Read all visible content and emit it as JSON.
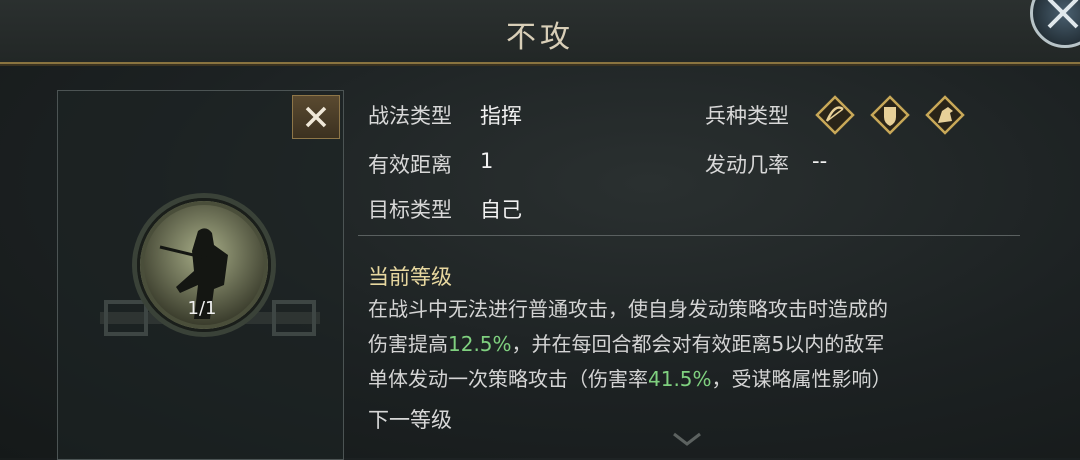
{
  "header": {
    "title": "不攻"
  },
  "skill": {
    "level_display": "1/1"
  },
  "info": {
    "tactic_type_label": "战法类型",
    "tactic_type_value": "指挥",
    "range_label": "有效距离",
    "range_value": "1",
    "target_label": "目标类型",
    "target_value": "自己",
    "unit_type_label": "兵种类型",
    "unit_icons": [
      "archer-icon",
      "shield-infantry-icon",
      "cavalry-icon"
    ],
    "trigger_label": "发动几率",
    "trigger_value": "--"
  },
  "current_level": {
    "title": "当前等级",
    "line1": "在战斗中无法进行普通攻击，使自身发动策略攻击时造成的",
    "line2_a": "伤害提高",
    "line2_hl": "12.5%",
    "line2_b": "，并在每回合都会对有效距离5以内的敌军",
    "line3_a": "单体发动一次策略攻击（伤害率",
    "line3_hl": "41.5%",
    "line3_b": "，受谋略属性影响）"
  },
  "next_level": {
    "title": "下一等级"
  },
  "colors": {
    "accent": "#8a7440",
    "highlight": "#7fd07f",
    "gold_text": "#e8d8a0"
  }
}
